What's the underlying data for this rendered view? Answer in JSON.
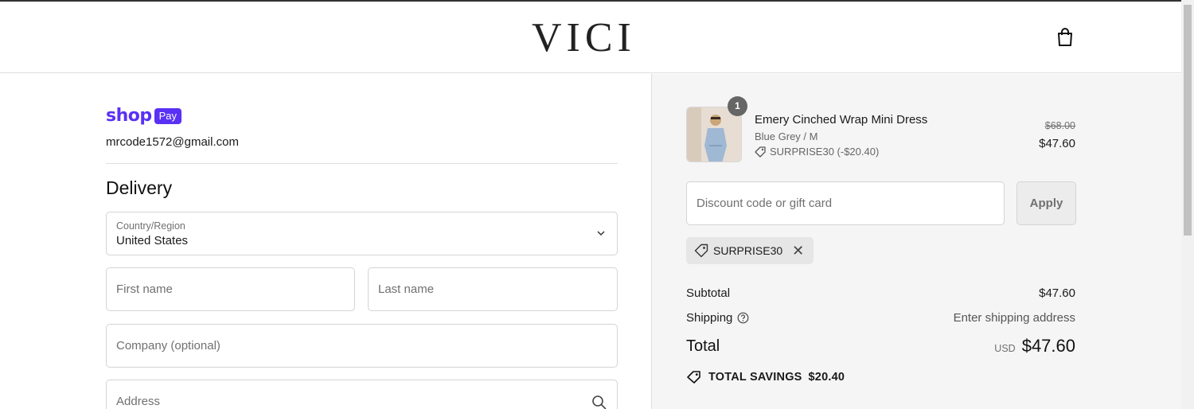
{
  "brand": {
    "logo": "VICI"
  },
  "express": {
    "shoppay_word": "shop",
    "shoppay_pay": "Pay"
  },
  "account": {
    "email": "mrcode1572@gmail.com"
  },
  "delivery": {
    "title": "Delivery",
    "country_label": "Country/Region",
    "country_value": "United States",
    "first_name_placeholder": "First name",
    "last_name_placeholder": "Last name",
    "company_placeholder": "Company (optional)",
    "address_placeholder": "Address"
  },
  "cart": {
    "item": {
      "quantity": "1",
      "name": "Emery Cinched Wrap Mini Dress",
      "variant": "Blue Grey / M",
      "discount": "SURPRISE30 (-$20.40)",
      "original_price": "$68.00",
      "price": "$47.60"
    },
    "discount_placeholder": "Discount code or gift card",
    "apply_label": "Apply",
    "applied_code": "SURPRISE30",
    "subtotal_label": "Subtotal",
    "subtotal_value": "$47.60",
    "shipping_label": "Shipping",
    "shipping_value": "Enter shipping address",
    "total_label": "Total",
    "total_currency": "USD",
    "total_value": "$47.60",
    "savings_label": "TOTAL SAVINGS",
    "savings_value": "$20.40"
  },
  "icons": {
    "cart": "shopping-bag-icon",
    "chevron": "chevron-down-icon",
    "search": "search-icon",
    "tag": "tag-icon",
    "close": "close-icon",
    "help": "question-circle-icon"
  },
  "colors": {
    "shoppay": "#5a31f4",
    "sidebar_bg": "#f5f5f5"
  }
}
